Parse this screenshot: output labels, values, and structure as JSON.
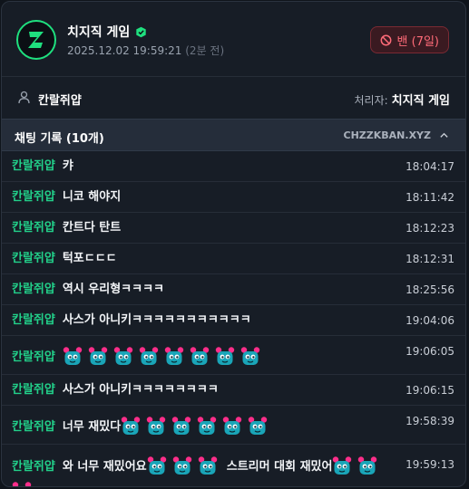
{
  "header": {
    "channel_title": "치지직 게임",
    "datetime": "2025.12.02 19:59:21",
    "relative_time": "(2분 전)",
    "ban_label": "밴 (7일)"
  },
  "user": {
    "name": "칸랄쥐얍",
    "handler_label": "처리자:",
    "handler_name": "치지직 게임"
  },
  "chat": {
    "title": "채팅 기록 (10개)",
    "site": "CHZZKBAN.XYZ",
    "rows": [
      {
        "nick": "칸랄쥐얍",
        "text": "캬",
        "time": "18:04:17"
      },
      {
        "nick": "칸랄쥐얍",
        "text": "니코 해야지",
        "time": "18:11:42"
      },
      {
        "nick": "칸랄쥐얍",
        "text": "칸트다 탄트",
        "time": "18:12:23"
      },
      {
        "nick": "칸랄쥐얍",
        "text": "턱포ㄷㄷㄷ",
        "time": "18:12:31"
      },
      {
        "nick": "칸랄쥐얍",
        "text": "역시 우리형ㅋㅋㅋㅋ",
        "time": "18:25:56"
      },
      {
        "nick": "칸랄쥐얍",
        "text": "사스가 아니키ㅋㅋㅋㅋㅋㅋㅋㅋㅋㅋㅋ",
        "time": "19:04:06"
      },
      {
        "nick": "칸랄쥐얍",
        "text": "",
        "time": "19:06:05"
      },
      {
        "nick": "칸랄쥐얍",
        "text": "사스가 아니키ㅋㅋㅋㅋㅋㅋㅋㅋ",
        "time": "19:06:15"
      },
      {
        "nick": "칸랄쥐얍",
        "text": "너무 재밌다",
        "time": "19:58:39"
      },
      {
        "nick": "칸랄쥐얍",
        "text": "와 너무 재밌어요",
        "text2": "스트리머 대회 재밌어",
        "time": "19:59:13"
      }
    ]
  },
  "icons": {
    "logo": "chzzk-logo-icon",
    "verified": "verified-badge-icon",
    "ban": "ban-icon",
    "user": "user-icon",
    "collapse": "chevron-up-icon",
    "emote": "blue-creature-emote-icon"
  },
  "colors": {
    "accent": "#1fe07f",
    "nick": "#22d08a",
    "ban": "#ff6b78",
    "emote_body": "#1aa5b8",
    "emote_horn": "#ff2e8a"
  }
}
